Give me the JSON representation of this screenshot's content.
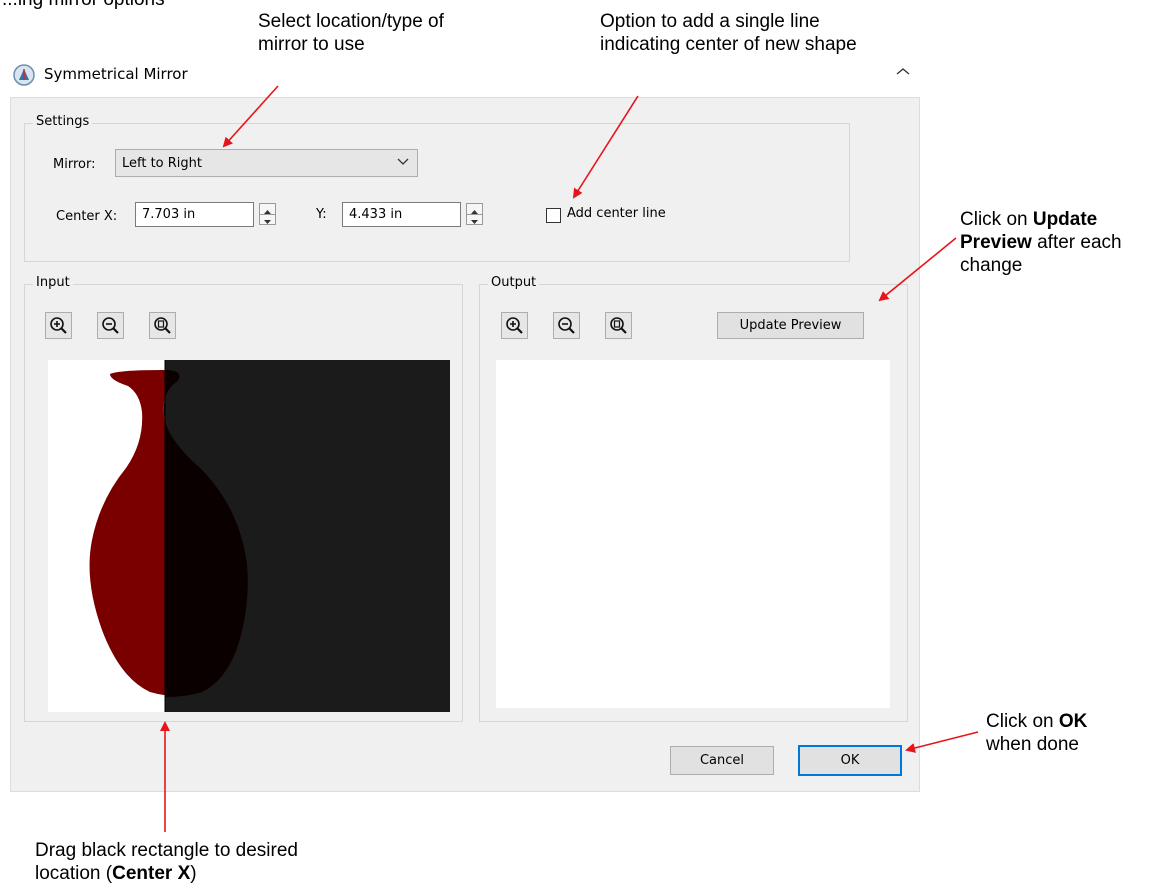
{
  "annotations": {
    "top_left_cut": "...ing mirror options",
    "select_mirror": [
      "Select location/type of",
      "mirror to use"
    ],
    "center_line": [
      "Option to add a single line",
      "indicating center of new shape"
    ],
    "update_preview_pre": "Click on ",
    "update_preview_bold1": "Update",
    "update_preview_bold2": "Preview",
    "update_preview_post": " after each",
    "update_preview_line3": "change",
    "ok_pre": "Click on ",
    "ok_bold": "OK",
    "ok_line2": "when done",
    "drag_line1": "Drag black rectangle to desired",
    "drag_line2_pre": "location (",
    "drag_line2_bold": "Center X",
    "drag_line2_post": ")",
    "arrow_color": "#e8141c"
  },
  "dialog": {
    "title": "Symmetrical Mirror",
    "settings": {
      "group_label": "Settings",
      "mirror_label": "Mirror:",
      "mirror_value": "Left to Right",
      "center_x_label": "Center X:",
      "center_x_value": "7.703 in",
      "y_label": "Y:",
      "y_value": "4.433 in",
      "center_line_label": "Add center line",
      "center_line_checked": false
    },
    "input": {
      "group_label": "Input",
      "zoom_in": "zoom-in-icon",
      "zoom_out": "zoom-out-icon",
      "zoom_fit": "zoom-fit-icon"
    },
    "output": {
      "group_label": "Output",
      "zoom_in": "zoom-in-icon",
      "zoom_out": "zoom-out-icon",
      "zoom_fit": "zoom-fit-icon",
      "update_preview": "Update Preview"
    },
    "buttons": {
      "cancel": "Cancel",
      "ok": "OK"
    },
    "colors": {
      "vase": "#7a0000",
      "mirror_overlay": "#141414",
      "default_button_border": "#0078d7"
    }
  }
}
